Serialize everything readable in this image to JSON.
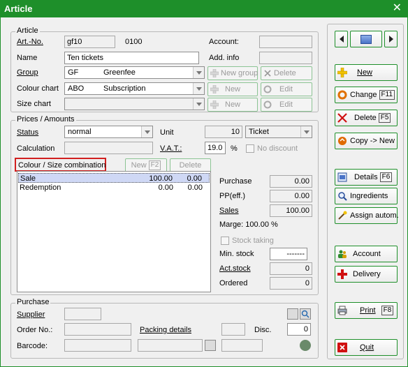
{
  "window": {
    "title": "Article",
    "close_glyph": "✕"
  },
  "article": {
    "group_title": "Article",
    "artno_label": "Art.-No.",
    "artno_value": "gf10",
    "artno_code": "0100",
    "account_label": "Account:",
    "name_label": "Name",
    "name_value": "Ten tickets",
    "addinfo_label": "Add. info",
    "group_label": "Group",
    "group_code": "GF",
    "group_name": "Greenfee",
    "new_group_label": "New group",
    "delete_label": "Delete",
    "colour_chart_label": "Colour chart",
    "colour_chart_code": "ABO",
    "colour_chart_name": "Subscription",
    "size_chart_label": "Size chart",
    "new_label": "New",
    "edit_label": "Edit"
  },
  "prices": {
    "group_title": "Prices / Amounts",
    "status_label": "Status",
    "status_value": "normal",
    "unit_label": "Unit",
    "unit_qty": "10",
    "unit_value": "Ticket",
    "calculation_label": "Calculation",
    "vat_label": "V.A.T.:",
    "vat_value": "19.0",
    "vat_unit": "%",
    "no_discount_label": "No discount",
    "combo_label": "Colour / Size combination",
    "combo_new_label": "New",
    "combo_new_key": "F2",
    "combo_delete_label": "Delete",
    "rows": [
      {
        "name": "Sale",
        "v1": "100.00",
        "v2": "0.00"
      },
      {
        "name": "Redemption",
        "v1": "0.00",
        "v2": "0.00"
      }
    ],
    "purchase_label": "Purchase",
    "purchase_value": "0.00",
    "pp_label": "PP(eff.)",
    "pp_value": "0.00",
    "sales_label": "Sales",
    "sales_value": "100.00",
    "marge_text": "Marge: 100.00 %",
    "stock_taking_label": "Stock taking",
    "min_stock_label": "Min. stock",
    "min_stock_value": "-------",
    "act_stock_label": "Act.stock",
    "act_stock_value": "0",
    "ordered_label": "Ordered",
    "ordered_value": "0"
  },
  "purchase": {
    "group_title": "Purchase",
    "supplier_label": "Supplier",
    "order_no_label": "Order No.:",
    "packing_label": "Packing details",
    "disc_label": "Disc.",
    "disc_value": "0",
    "barcode_label": "Barcode:"
  },
  "side": {
    "new_label": "New",
    "change_label": "Change",
    "change_key": "F11",
    "delete_label": "Delete",
    "delete_key": "F5",
    "copy_label": "Copy -> New",
    "details_label": "Details",
    "details_key": "F6",
    "ingredients_label": "Ingredients",
    "assign_label": "Assign autom.",
    "account_label": "Account",
    "delivery_label": "Delivery",
    "print_label": "Print",
    "print_key": "F8",
    "quit_label": "Quit"
  },
  "colors": {
    "accent": "#1e8f2a",
    "highlight_box": "#d11f1f",
    "selection": "#cfd8f5"
  }
}
